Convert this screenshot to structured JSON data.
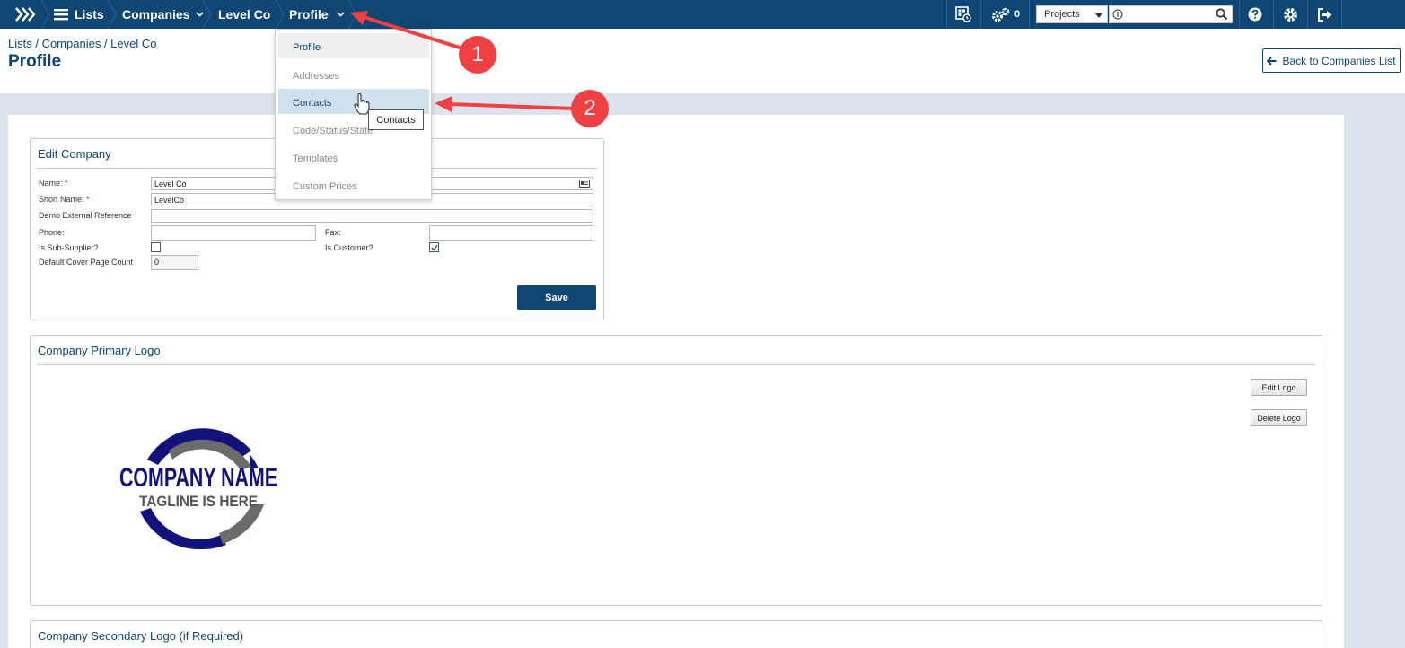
{
  "nav": {
    "lists_label": "Lists",
    "companies_label": "Companies",
    "company_label": "Level Co",
    "profile_label": "Profile",
    "notification_count": "0",
    "project_select_value": "Projects",
    "accent": "#0f4673"
  },
  "header": {
    "breadcrumb": "Lists / Companies / Level Co",
    "title": "Profile",
    "back_button": "Back to Companies List"
  },
  "profile_menu": {
    "items": [
      "Profile",
      "Addresses",
      "Contacts",
      "Code/Status/State",
      "Templates",
      "Custom Prices"
    ],
    "tooltip": "Contacts"
  },
  "edit_company": {
    "title": "Edit Company",
    "name_label": "Name:",
    "name_value": "Level Co",
    "short_name_label": "Short Name:",
    "short_name_value": "LevelCo",
    "demo_ref_label": "Demo External Reference",
    "phone_label": "Phone:",
    "fax_label": "Fax:",
    "sub_supplier_label": "Is Sub-Supplier?",
    "customer_label": "Is Customer?",
    "cover_count_label": "Default Cover Page Count",
    "cover_count_value": "0",
    "required_marker": "*",
    "save_button": "Save"
  },
  "primary_logo": {
    "title": "Company Primary Logo",
    "edit_button": "Edit Logo",
    "delete_button": "Delete Logo",
    "logo_name": "COMPANY NAME",
    "logo_tagline": "TAGLINE IS HERE"
  },
  "secondary_logo": {
    "title": "Company Secondary Logo (if Required)"
  },
  "annotations": {
    "step1": "1",
    "step2": "2",
    "arrow_color": "#ef4044"
  }
}
